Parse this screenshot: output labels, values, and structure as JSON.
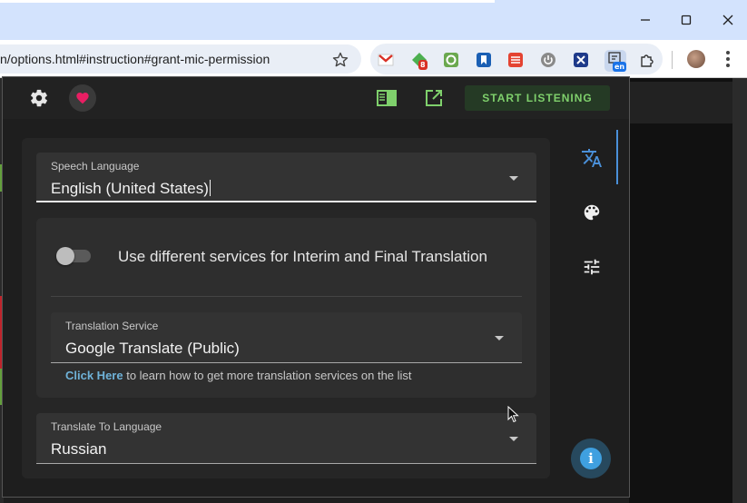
{
  "browser": {
    "url": "n/options.html#instruction#grant-mic-permission",
    "extension_badges": {
      "red_badge": "8",
      "language_badge": "en"
    }
  },
  "popup": {
    "start_button_label": "START LISTENING",
    "speech_language": {
      "label": "Speech Language",
      "value": "English (United States)"
    },
    "toggle": {
      "label": "Use different services for Interim and Final Translation",
      "on": false
    },
    "translation_service": {
      "label": "Translation Service",
      "value": "Google Translate (Public)"
    },
    "hint": {
      "link_text": "Click Here",
      "rest_text": " to learn how to get more translation services on the list"
    },
    "translate_to": {
      "label": "Translate To Language",
      "value": "Russian"
    },
    "info_glyph": "i"
  },
  "colors": {
    "accent_green": "#7fd06c",
    "heart_pink": "#e91e63",
    "active_tab_blue": "#4a90d9",
    "link_blue": "#6fb2d8"
  },
  "icons": [
    "gear-icon",
    "heart-icon",
    "sidebar-icon",
    "open-external-icon",
    "translate-icon",
    "palette-icon",
    "tune-icon",
    "info-icon",
    "star-icon",
    "puzzle-icon",
    "kebab-icon",
    "minimize-icon",
    "maximize-icon",
    "close-icon"
  ]
}
